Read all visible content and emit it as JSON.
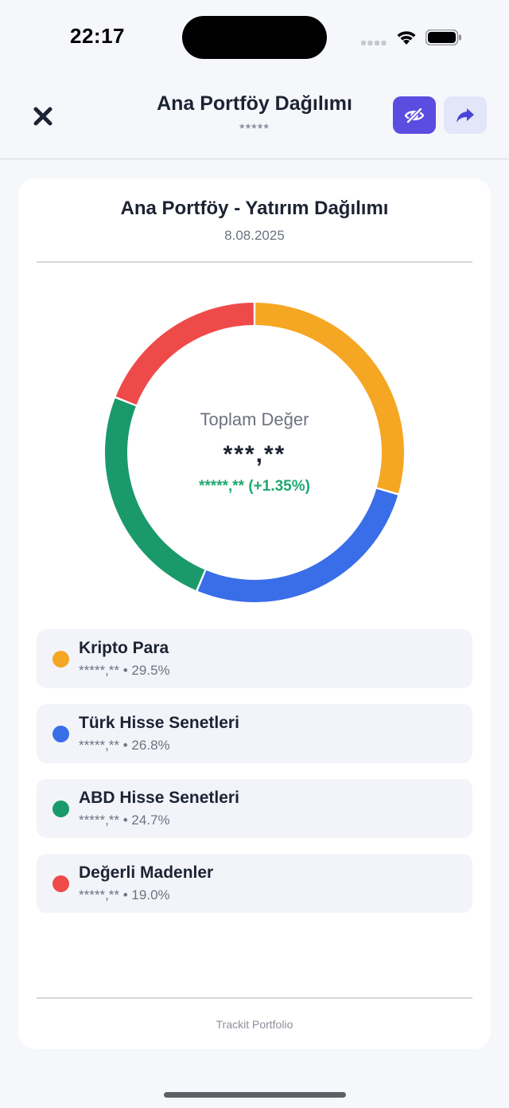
{
  "status": {
    "time": "22:17"
  },
  "header": {
    "title": "Ana Portföy Dağılımı",
    "subtitle": "*****",
    "privacy_icon": "eye-slash-icon",
    "share_icon": "share-arrow-icon",
    "close_icon": "close-icon"
  },
  "card": {
    "title": "Ana Portföy - Yatırım Dağılımı",
    "date": "8.08.2025",
    "center_label": "Toplam Değer",
    "center_value": "***,**",
    "center_change": "*****,** (+1.35%)",
    "footer": "Trackit Portfolio"
  },
  "chart_data": {
    "type": "pie",
    "categories": [
      "Kripto Para",
      "Türk Hisse Senetleri",
      "ABD Hisse Senetleri",
      "Değerli Madenler"
    ],
    "values": [
      29.5,
      26.8,
      24.7,
      19.0
    ],
    "colors": [
      "#f5a623",
      "#3a6ee8",
      "#1a9a6b",
      "#ef4a4a"
    ],
    "style": "donut"
  },
  "legend": [
    {
      "name": "Kripto Para",
      "detail": "*****,** • 29.5%",
      "color": "#f5a623"
    },
    {
      "name": "Türk Hisse Senetleri",
      "detail": "*****,** • 26.8%",
      "color": "#3a6ee8"
    },
    {
      "name": "ABD Hisse Senetleri",
      "detail": "*****,** • 24.7%",
      "color": "#1a9a6b"
    },
    {
      "name": "Değerli Madenler",
      "detail": "*****,** • 19.0%",
      "color": "#ef4a4a"
    }
  ]
}
